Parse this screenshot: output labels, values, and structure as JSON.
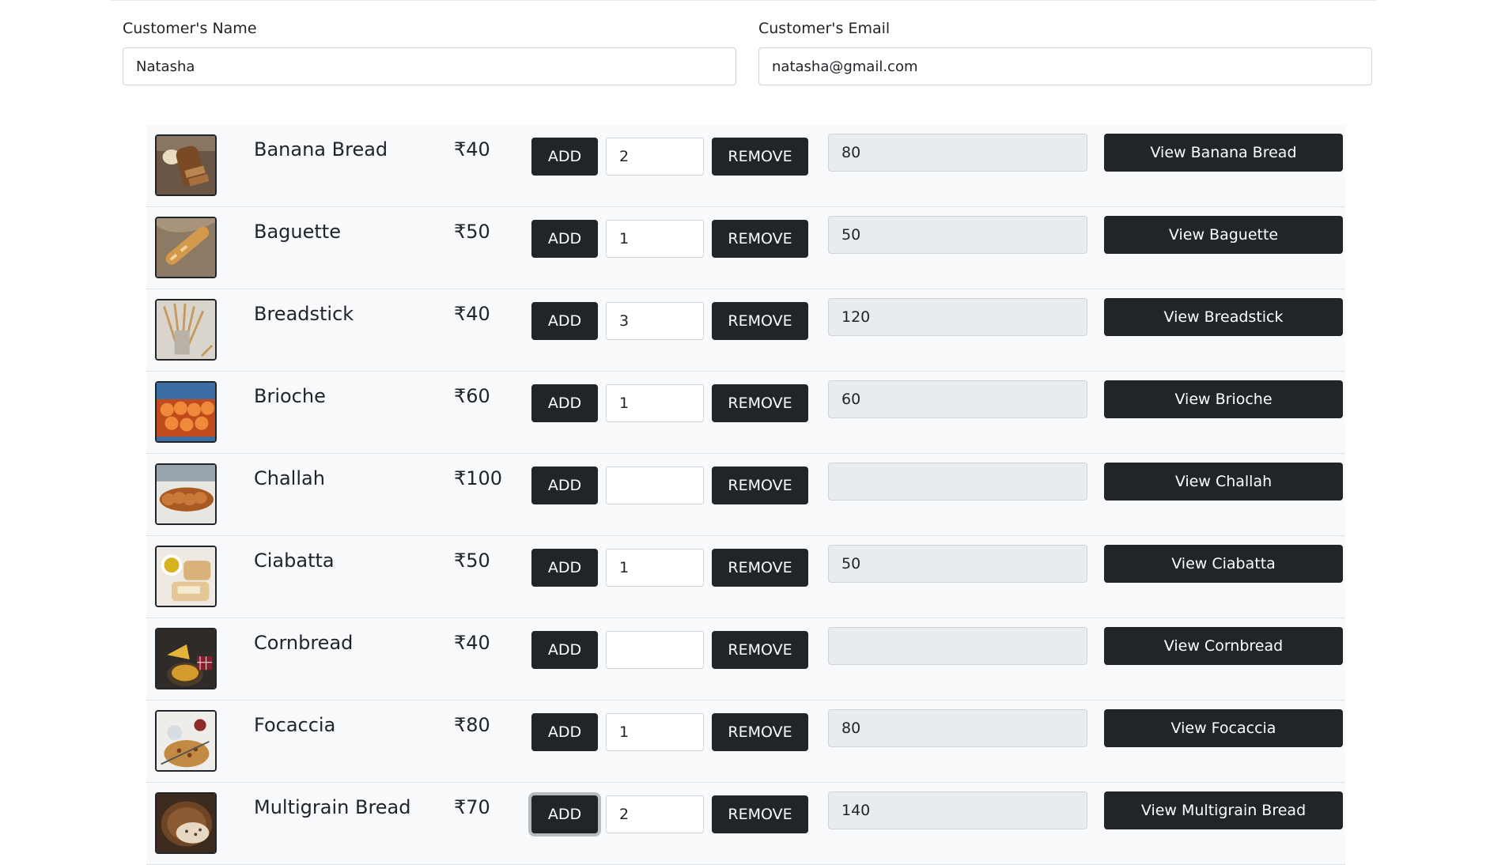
{
  "customer": {
    "name_label": "Customer's Name",
    "name_value": "Natasha",
    "email_label": "Customer's Email",
    "email_value": "natasha@gmail.com"
  },
  "buttons": {
    "add_label": "ADD",
    "remove_label": "REMOVE"
  },
  "colors": {
    "dark_button": "#212529",
    "readonly_field": "#e9ecef",
    "row_background": "#f8f9fa"
  },
  "products": [
    {
      "name": "Banana Bread",
      "price": "₹40",
      "quantity": "2",
      "total": "80",
      "view_label": "View Banana Bread",
      "image": "banana-bread-photo"
    },
    {
      "name": "Baguette",
      "price": "₹50",
      "quantity": "1",
      "total": "50",
      "view_label": "View Baguette",
      "image": "baguette-photo"
    },
    {
      "name": "Breadstick",
      "price": "₹40",
      "quantity": "3",
      "total": "120",
      "view_label": "View Breadstick",
      "image": "breadstick-photo"
    },
    {
      "name": "Brioche",
      "price": "₹60",
      "quantity": "1",
      "total": "60",
      "view_label": "View Brioche",
      "image": "brioche-photo"
    },
    {
      "name": "Challah",
      "price": "₹100",
      "quantity": "",
      "total": "",
      "view_label": "View Challah",
      "image": "challah-photo"
    },
    {
      "name": "Ciabatta",
      "price": "₹50",
      "quantity": "1",
      "total": "50",
      "view_label": "View Ciabatta",
      "image": "ciabatta-photo"
    },
    {
      "name": "Cornbread",
      "price": "₹40",
      "quantity": "",
      "total": "",
      "view_label": "View Cornbread",
      "image": "cornbread-photo"
    },
    {
      "name": "Focaccia",
      "price": "₹80",
      "quantity": "1",
      "total": "80",
      "view_label": "View Focaccia",
      "image": "focaccia-photo"
    },
    {
      "name": "Multigrain Bread",
      "price": "₹70",
      "quantity": "2",
      "total": "140",
      "view_label": "View Multigrain Bread",
      "image": "multigrain-bread-photo"
    }
  ]
}
